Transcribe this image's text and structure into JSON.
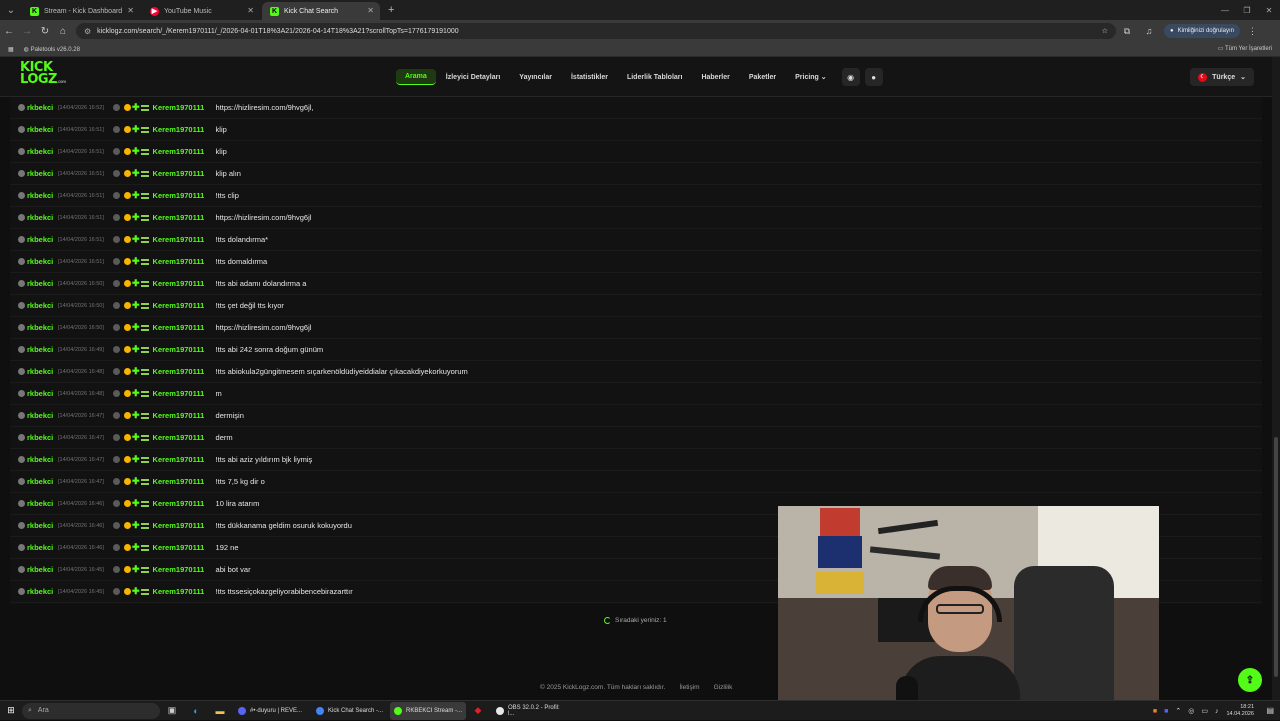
{
  "browser": {
    "tabs": [
      {
        "title": "Stream - Kick Dashboard",
        "color": "#53fc18",
        "letter": "K"
      },
      {
        "title": "YouTube Music",
        "color": "#ff0033",
        "letter": "▶"
      },
      {
        "title": "Kick Chat Search",
        "color": "#53fc18",
        "letter": "K"
      }
    ],
    "url": "kicklogz.com/search/_/Kerem1970111/_/2026-04-01T18%3A21/2026-04-14T18%3A21?scrollTopTs=1776179191000",
    "profile_label": "Kimliğinizi doğrulayın",
    "bookmark": "Paletools v26.0.28",
    "bookmarks_all": "Tüm Yer İşaretleri"
  },
  "site": {
    "logo_top": "KICK",
    "logo_bottom": "LOGZ",
    "logo_suffix": ".com",
    "nav": [
      "Arama",
      "İzleyici Detayları",
      "Yayıncılar",
      "İstatistikler",
      "Liderlik Tabloları",
      "Haberler",
      "Paketler",
      "Pricing"
    ],
    "language": "Türkçe",
    "messages": [
      {
        "channel": "rkbekci",
        "time": "[14/04/2026 16:52]",
        "user": "Kerem1970111",
        "text": "https://hizliresim.com/9hvg6jl,"
      },
      {
        "channel": "rkbekci",
        "time": "[14/04/2026 16:51]",
        "user": "Kerem1970111",
        "text": "klip"
      },
      {
        "channel": "rkbekci",
        "time": "[14/04/2026 16:51]",
        "user": "Kerem1970111",
        "text": "klip"
      },
      {
        "channel": "rkbekci",
        "time": "[14/04/2026 16:51]",
        "user": "Kerem1970111",
        "text": "klip alın"
      },
      {
        "channel": "rkbekci",
        "time": "[14/04/2026 16:51]",
        "user": "Kerem1970111",
        "text": "!tts clip"
      },
      {
        "channel": "rkbekci",
        "time": "[14/04/2026 16:51]",
        "user": "Kerem1970111",
        "text": "https://hizliresim.com/9hvg6jl"
      },
      {
        "channel": "rkbekci",
        "time": "[14/04/2026 16:51]",
        "user": "Kerem1970111",
        "text": "!tts dolandırma*"
      },
      {
        "channel": "rkbekci",
        "time": "[14/04/2026 16:51]",
        "user": "Kerem1970111",
        "text": "!tts domaldırma"
      },
      {
        "channel": "rkbekci",
        "time": "[14/04/2026 16:50]",
        "user": "Kerem1970111",
        "text": "!tts abi adamı dolandırma a"
      },
      {
        "channel": "rkbekci",
        "time": "[14/04/2026 16:50]",
        "user": "Kerem1970111",
        "text": "!tts çet değil tts kıyor"
      },
      {
        "channel": "rkbekci",
        "time": "[14/04/2026 16:50]",
        "user": "Kerem1970111",
        "text": "https://hizliresim.com/9hvg6jl"
      },
      {
        "channel": "rkbekci",
        "time": "[14/04/2026 16:49]",
        "user": "Kerem1970111",
        "text": "!tts abi 242 sonra doğum günüm"
      },
      {
        "channel": "rkbekci",
        "time": "[14/04/2026 16:48]",
        "user": "Kerem1970111",
        "text": "!tts abiokula2güngitmesem sıçarkenöldüdiyeiddialar çıkacakdiyekorkuyorum"
      },
      {
        "channel": "rkbekci",
        "time": "[14/04/2026 16:48]",
        "user": "Kerem1970111",
        "text": "m"
      },
      {
        "channel": "rkbekci",
        "time": "[14/04/2026 16:47]",
        "user": "Kerem1970111",
        "text": "dermişin"
      },
      {
        "channel": "rkbekci",
        "time": "[14/04/2026 16:47]",
        "user": "Kerem1970111",
        "text": "derm"
      },
      {
        "channel": "rkbekci",
        "time": "[14/04/2026 16:47]",
        "user": "Kerem1970111",
        "text": "!tts abi aziz yıldırım bjk liymiş"
      },
      {
        "channel": "rkbekci",
        "time": "[14/04/2026 16:47]",
        "user": "Kerem1970111",
        "text": "!tts 7,5 kg dir o"
      },
      {
        "channel": "rkbekci",
        "time": "[14/04/2026 16:46]",
        "user": "Kerem1970111",
        "text": "10 lira atarım"
      },
      {
        "channel": "rkbekci",
        "time": "[14/04/2026 16:46]",
        "user": "Kerem1970111",
        "text": "!tts dükkanama geldim osuruk kokuyordu"
      },
      {
        "channel": "rkbekci",
        "time": "[14/04/2026 16:46]",
        "user": "Kerem1970111",
        "text": "192 ne"
      },
      {
        "channel": "rkbekci",
        "time": "[14/04/2026 16:45]",
        "user": "Kerem1970111",
        "text": "abi bot var"
      },
      {
        "channel": "rkbekci",
        "time": "[14/04/2026 16:45]",
        "user": "Kerem1970111",
        "text": "!tts ttssesiçokazgeliyorabibencebirazarttır"
      }
    ],
    "queue_text": "Sıradaki yeriniz: 1",
    "footer": {
      "copyright": "© 2025 KickLogz.com. Tüm hakları saklıdır.",
      "contact": "İletişim",
      "privacy": "Gizlilik"
    }
  },
  "taskbar": {
    "search_placeholder": "Ara",
    "apps": [
      {
        "label": "#•·duyuru | REVE...",
        "color": "#5865f2"
      },
      {
        "label": "Kick Chat Search -...",
        "color": "#4285f4"
      },
      {
        "label": "RKBEKCI Stream -...",
        "color": "#53fc18"
      },
      {
        "label": "OBS 32.0.2 - Profil: l...",
        "color": "#e8e8e8"
      }
    ],
    "time": "18:21",
    "date": "14.04.2026"
  }
}
